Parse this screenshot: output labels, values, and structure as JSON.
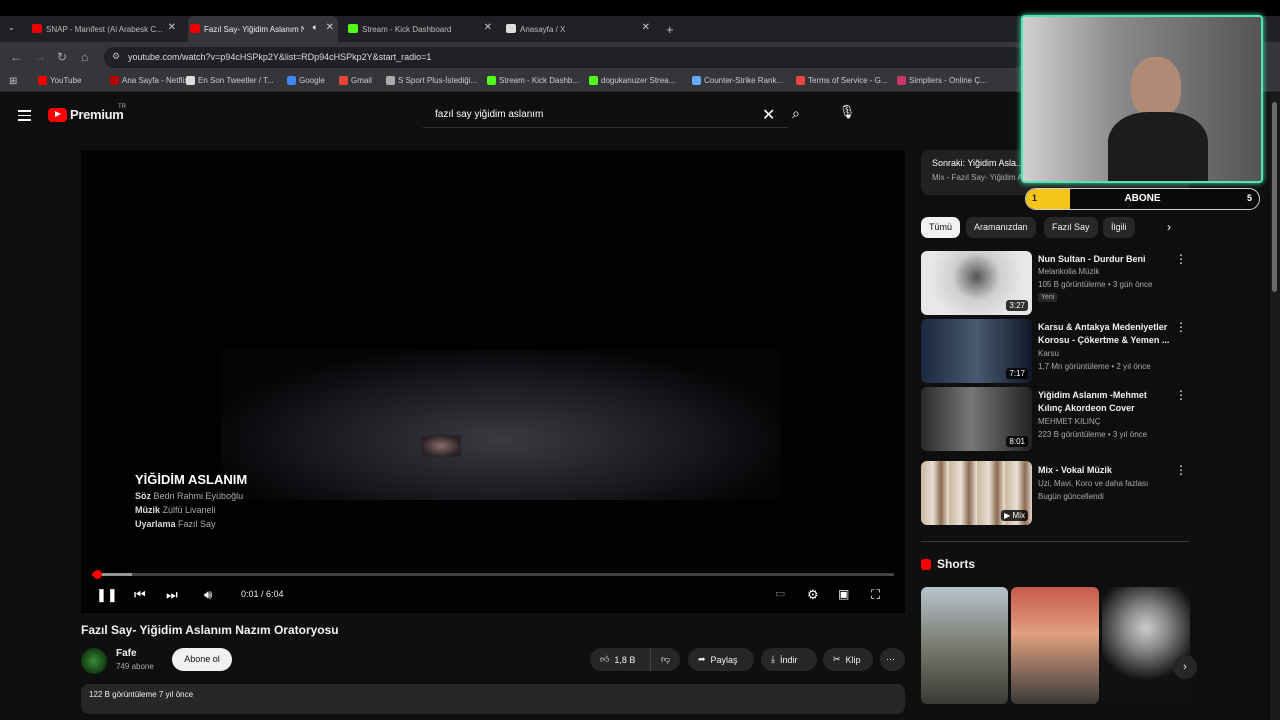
{
  "browser": {
    "tabs": [
      {
        "label": "SNAP - Manifest (Ai Arabesk C...",
        "fav": "#e00"
      },
      {
        "label": "Fazıl Say- Yiğidim Aslanım N...",
        "fav": "#e00"
      },
      {
        "label": "Stream - Kick Dashboard",
        "fav": "#53fc18"
      },
      {
        "label": "Anasayfa / X",
        "fav": "#ddd"
      }
    ],
    "new_tab": "+",
    "url": "youtube.com/watch?v=p94cHSPkp2Y&list=RDp94cHSPkp2Y&start_radio=1",
    "bookmarks": [
      {
        "label": "YouTube",
        "c": "#e00"
      },
      {
        "label": "Ana Sayfa - Netflix",
        "c": "#b00"
      },
      {
        "label": "En Son Tweetler / T...",
        "c": "#ddd"
      },
      {
        "label": "Google",
        "c": "#4285f4"
      },
      {
        "label": "Gmail",
        "c": "#ea4335"
      },
      {
        "label": "S Sport Plus-İstediği...",
        "c": "#aaa"
      },
      {
        "label": "Stream - Kick Dashb...",
        "c": "#53fc18"
      },
      {
        "label": "dogukanuzer Strea...",
        "c": "#53fc18"
      },
      {
        "label": "Counter-Strike Rank...",
        "c": "#6af"
      },
      {
        "label": "Terms of Service - G...",
        "c": "#e44"
      },
      {
        "label": "Simpliers - Online Ç...",
        "c": "#c36"
      }
    ]
  },
  "yt": {
    "logo": "Premium",
    "region": "TR",
    "search_query": "fazıl say yiğidim aslanım"
  },
  "player": {
    "overlay_title": "YİĞİDİM ASLANIM",
    "credits": [
      {
        "k": "Söz",
        "v": "Bedri Rahmi Eyüboğlu"
      },
      {
        "k": "Müzik",
        "v": "Zülfü Livaneli"
      },
      {
        "k": "Uyarlama",
        "v": "Fazıl Say"
      }
    ],
    "time": "0:01 / 6:04",
    "played_fraction": 0.003,
    "buffered_fraction": 0.05
  },
  "video": {
    "title": "Fazıl Say- Yiğidim Aslanım Nazım Oratoryosu",
    "channel": "Fafe",
    "subs": "749 abone",
    "subscribe": "Abone ol",
    "likes": "1,8 B",
    "share": "Paylaş",
    "download": "İndir",
    "clip": "Klip",
    "views": "122 B görüntüleme  7 yıl önce"
  },
  "sidebar": {
    "upnext_label": "Sonraki:",
    "upnext_title": "Yiğidim Asla...",
    "upnext_sub": "Mix - Fazıl Say- Yiğidim A...",
    "chips": [
      "Tümü",
      "Aramanızdan",
      "Fazıl Say",
      "İlgili"
    ],
    "recs": [
      {
        "title": "Nun Sultan - Durdur Beni",
        "channel": "Melankolia Müzik",
        "meta": "105 B görüntüleme • 3 gün önce",
        "dur": "3:27",
        "badge": "Yeni"
      },
      {
        "title": "Karsu & Antakya Medeniyetler Korosu - Çökertme & Yemen ...",
        "channel": "Karsu",
        "meta": "1,7 Mn görüntüleme • 2 yıl önce",
        "dur": "7:17"
      },
      {
        "title": "Yiğidim Aslanım -Mehmet Kılınç Akordeon Cover",
        "channel": "MEHMET KILINÇ",
        "meta": "223 B görüntüleme • 3 yıl önce",
        "dur": "8:01"
      },
      {
        "title": "Mix - Vokal Müzik",
        "channel": "Uzi, Mavi, Koro ve daha fazlası",
        "meta": "Bugün güncellendi",
        "dur": "Mix"
      }
    ],
    "shorts_title": "Shorts"
  },
  "overlay": {
    "bar_label": "ABONE",
    "left_count": "1",
    "right_count": "5",
    "accent": "#4de8b0"
  }
}
